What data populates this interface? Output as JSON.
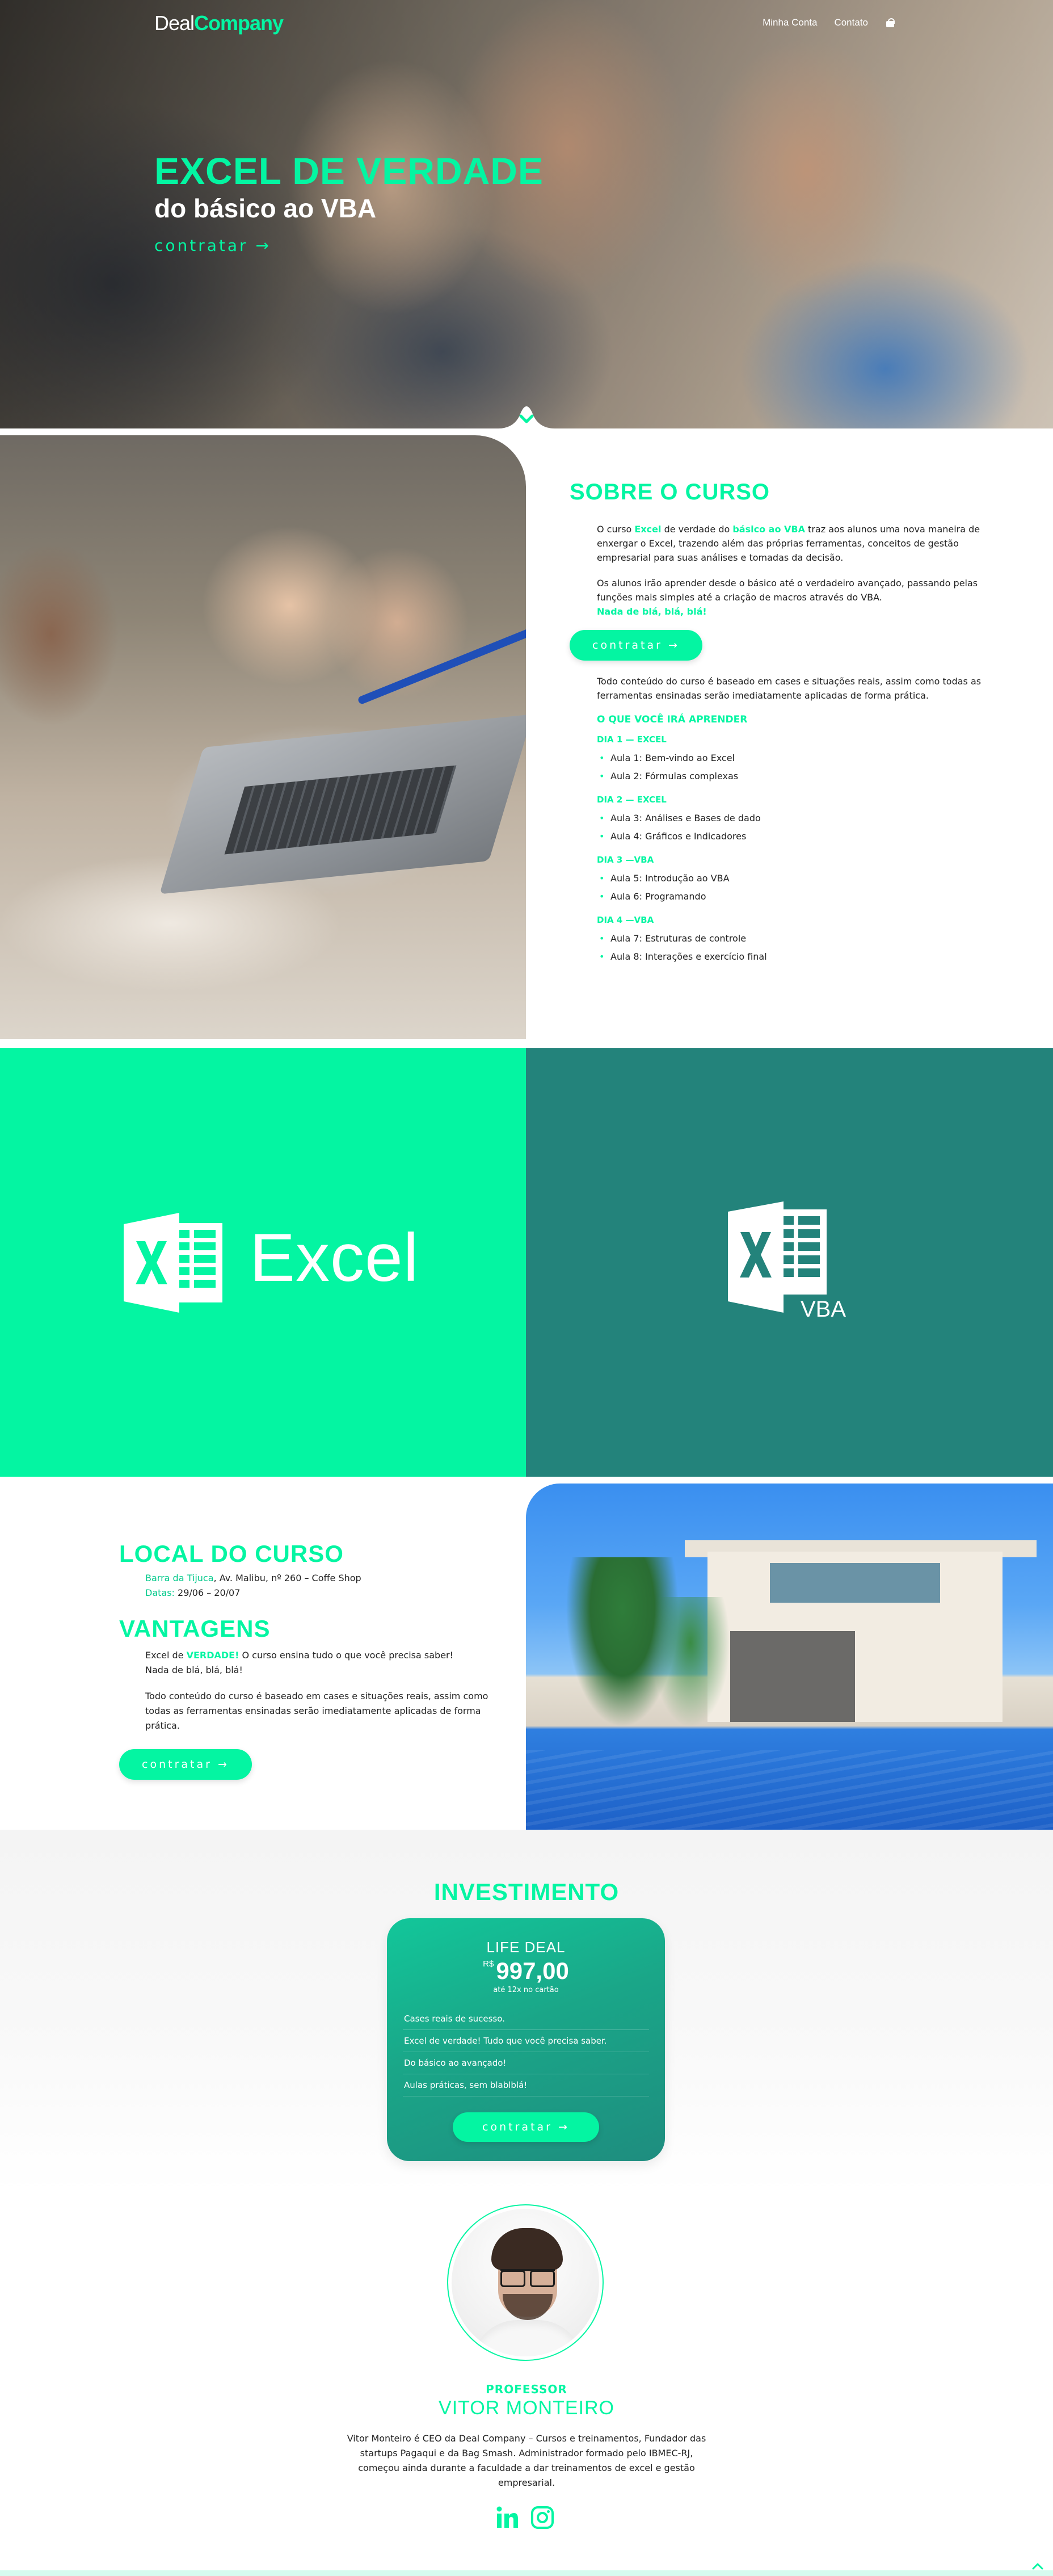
{
  "header": {
    "logo_part1": "Deal",
    "logo_part2": "Company",
    "nav": [
      "Minha Conta",
      "Contato"
    ],
    "cart_icon": "shopping-bag-icon"
  },
  "hero": {
    "title": "EXCEL DE VERDADE",
    "subtitle": "do básico ao VBA",
    "cta": "contratar →",
    "scroll_icon": "chevron-down-icon"
  },
  "about": {
    "title": "SOBRE O CURSO",
    "p1_a": "O curso ",
    "p1_b": "Excel",
    "p1_c": " de verdade do ",
    "p1_d": "básico ao VBA",
    "p1_e": " traz aos alunos uma nova maneira de enxergar o Excel, trazendo além das próprias ferramentas, conceitos de gestão empresarial para suas análises e tomadas da decisão.",
    "p2": "Os alunos irão aprender desde o básico até o verdadeiro avançado, passando pelas funções mais simples até a criação de macros através do VBA.",
    "p2_hl": "Nada de blá, blá, blá!",
    "cta": "contratar →",
    "p3": "Todo conteúdo do curso é baseado em cases e situações reais, assim como todas as ferramentas ensinadas serão imediatamente aplicadas de forma prática.",
    "learn_title": "O QUE VOCÊ IRÁ APRENDER",
    "days": [
      {
        "label": "DIA 1 — EXCEL",
        "lessons": [
          "Aula 1: Bem-vindo ao Excel",
          "Aula 2: Fórmulas complexas"
        ]
      },
      {
        "label": "DIA 2 — EXCEL",
        "lessons": [
          "Aula 3: Análises e Bases de dado",
          "Aula 4: Gráficos e Indicadores"
        ]
      },
      {
        "label": "DIA 3 —VBA",
        "lessons": [
          "Aula 5: Introdução ao VBA",
          "Aula 6: Programando"
        ]
      },
      {
        "label": "DIA 4 —VBA",
        "lessons": [
          "Aula 7: Estruturas de controle",
          "Aula 8: Interações e exercício final"
        ]
      }
    ]
  },
  "logos": {
    "excel_word": "Excel",
    "vba_word": "VBA",
    "excel_color": "#04f5a2",
    "vba_color": "#23837b"
  },
  "local": {
    "title": "LOCAL DO CURSO",
    "place_hl": "Barra da Tijuca",
    "place": ", Av. Malibu, nº 260 – Coffe Shop",
    "dates_hl": "Datas:",
    "dates": " 29/06 – 20/07",
    "adv_title": "VANTAGENS",
    "adv_a": "Excel de ",
    "adv_b": "VERDADE!",
    "adv_c": " O curso ensina tudo o que você precisa saber!",
    "adv_d": "Nada de blá, blá, blá!",
    "adv_p2": "Todo conteúdo do curso é baseado em cases e situações reais, assim como todas as ferramentas ensinadas serão imediatamente aplicadas de forma prática.",
    "cta": "contratar →"
  },
  "invest": {
    "title": "INVESTIMENTO",
    "plan": "LIFE DEAL",
    "currency": "R$",
    "price": "997,00",
    "installments": "até 12x no cartão",
    "features": [
      "Cases reais de sucesso.",
      "Excel de verdade! Tudo que você precisa saber.",
      "Do básico ao avançado!",
      "Aulas práticas, sem blablblá!"
    ],
    "cta": "contratar →"
  },
  "professor": {
    "label": "PROFESSOR",
    "name": "VITOR MONTEIRO",
    "bio": "Vitor Monteiro é CEO da Deal Company – Cursos e treinamentos, Fundador das startups Pagaqui e da Bag Smash. Administrador formado pelo IBMEC-RJ, começou ainda durante a faculdade a dar treinamentos de excel e gestão empresarial.",
    "social": [
      "linkedin-icon",
      "instagram-icon"
    ]
  },
  "colors": {
    "accent": "#04f5a2",
    "teal": "#23837b"
  }
}
